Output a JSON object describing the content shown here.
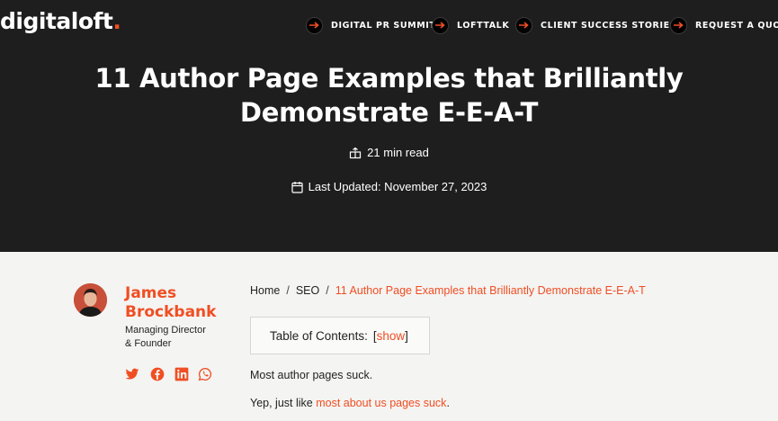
{
  "brand": {
    "name": "digitaloft",
    "dot": ".",
    "accent": "#f04e23"
  },
  "nav": {
    "items": [
      {
        "label": "DIGITAL PR SUMMIT"
      },
      {
        "label": "LOFTTALK"
      },
      {
        "label": "CLIENT SUCCESS STORIES"
      },
      {
        "label": "REQUEST A QUOTE"
      }
    ]
  },
  "article": {
    "title_line1": "11 Author Page Examples that Brilliantly",
    "title_line2": "Demonstrate E-E-A-T",
    "read_time": "21 min read",
    "last_updated": "Last Updated: November 27, 2023"
  },
  "author": {
    "first_name": "James",
    "last_name": "Brockbank",
    "role_line1": "Managing Director",
    "role_line2": "& Founder",
    "social": [
      "twitter-icon",
      "facebook-icon",
      "linkedin-icon",
      "whatsapp-icon"
    ]
  },
  "breadcrumb": {
    "home": "Home",
    "separator": "/",
    "category": "SEO",
    "current": "11 Author Page Examples that Brilliantly Demonstrate E-E-A-T"
  },
  "toc": {
    "label": "Table of Contents:",
    "open_bracket": "[",
    "toggle": "show",
    "close_bracket": "]"
  },
  "body": {
    "p1": "Most author pages suck.",
    "p2_prefix": "Yep, just like ",
    "p2_link": "most about us pages suck",
    "p2_suffix": "."
  }
}
